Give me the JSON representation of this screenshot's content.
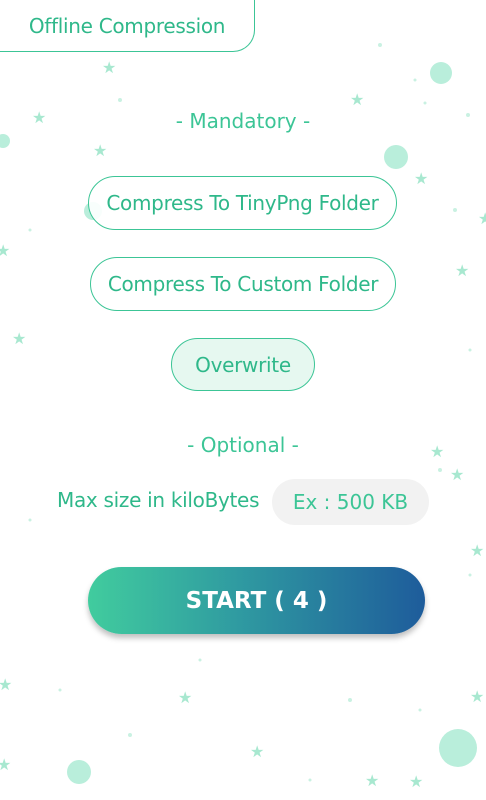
{
  "header": {
    "title": "Offline Compression"
  },
  "mandatory": {
    "heading": "- Mandatory -",
    "options": [
      {
        "label": "Compress To TinyPng Folder",
        "selected": false
      },
      {
        "label": "Compress To Custom Folder",
        "selected": false
      },
      {
        "label": "Overwrite",
        "selected": true
      }
    ]
  },
  "optional": {
    "heading": "- Optional -",
    "max_size_label": "Max size in kiloBytes",
    "max_size_placeholder": "Ex : 500 KB",
    "max_size_value": ""
  },
  "start_button": {
    "label": "START ( 4 )"
  },
  "colors": {
    "accent": "#3cc596",
    "gradient_start": "#41cc9e",
    "gradient_end": "#1e5c9b",
    "decoration": "#b9eedb"
  }
}
